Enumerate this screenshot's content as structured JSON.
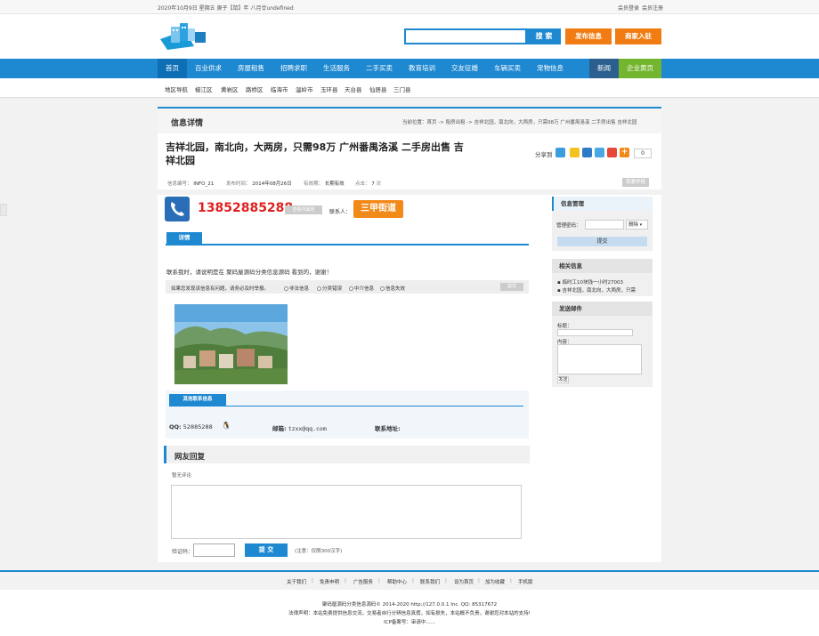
{
  "topbar": {
    "date": "2020年10月9日 星期五  庚子【鼠】年 八月廿undefined",
    "login": "会员登录",
    "register": "会员注册"
  },
  "header": {
    "search_placeholder": "",
    "search_button": "搜 索",
    "post_button": "发布信息",
    "merchant_button": "商家入驻"
  },
  "nav": {
    "items": [
      "首页",
      "百业供求",
      "房屋租售",
      "招聘求职",
      "生活服务",
      "二手买卖",
      "教育培训",
      "交友征婚",
      "车辆买卖",
      "宠物信息"
    ],
    "news": "新闻",
    "biz": "企业黄页"
  },
  "subnav": {
    "items": [
      "地区导航",
      "椒江区",
      "黄岩区",
      "路桥区",
      "临海市",
      "温岭市",
      "玉环县",
      "天台县",
      "仙居县",
      "三门县"
    ]
  },
  "title_bar": {
    "title": "信息详情",
    "breadcrumb": "当前位置：首页 -> 租房出租 -> 吉祥北园，南北向，大两房，只需98万 广州番禺洛溪 二手房出售 吉祥北园"
  },
  "post": {
    "title_line1": "吉祥北园，南北向，大两房，只需98万 广州番禺洛溪 二手房出售 吉",
    "title_line2": "祥北园",
    "share_label": "分享到",
    "share_count": "0",
    "meta": {
      "id_label": "信息编号：",
      "id_value": "INFO_21",
      "date_label": "发布时间：",
      "date_value": "2014年08月26日",
      "valid_label": "有效期：",
      "valid_value": "长期有效",
      "views_label": "点击：",
      "views_value": "7",
      "views_unit": "次"
    },
    "report_button": "我要举报",
    "phone": "13852885288",
    "phone_btn": "查看归属地",
    "contact_label": "联系人：",
    "contact_name": "三甲街道",
    "tab_detail": "详情",
    "description": "联系我时，请说明是在 聚码屋源码分类信息源码 看到的，谢谢！",
    "report_text": "如果您发现该信息有问题，请务必及时举报。",
    "report_options": [
      "非法信息",
      "分类错误",
      "中介信息",
      "信息失效"
    ],
    "report_submit": "提交"
  },
  "other_contact": {
    "tab": "其他联系信息",
    "qq_label": "QQ:",
    "qq_value": "52885288",
    "email_label": "邮箱:",
    "email_value": "tzxx@qq.com",
    "address_label": "联系地址:"
  },
  "reply": {
    "title": "网友回复",
    "no_comment": "暂无评论",
    "code_label": "验证码：",
    "submit": "提 交",
    "note": "(注意：仅限300汉字)"
  },
  "sidebar": {
    "manage": {
      "title": "信息管理",
      "password_label": "管理密码：",
      "action_select": "删除",
      "submit": "提交"
    },
    "related": {
      "title": "相关信息",
      "items": [
        "临时工10块钱一小时27003",
        "吉祥北园，南北向，大两房，只需"
      ]
    },
    "mail": {
      "title": "发送邮件",
      "subject_label": "标题：",
      "content_label": "内容：",
      "send_button": "发送"
    }
  },
  "footer": {
    "links": [
      "关于我们",
      "免责申明",
      "广告服务",
      "帮助中心",
      "联系我们",
      "设为首页",
      "加为收藏",
      "手机版"
    ],
    "copyright": "聚码屋源码分类信息源码© 2014-2020 http://127.0.0.1 Inc. QQ: 85317672",
    "disclaimer": "法律声明：本站免费提供信息交流，交易者自行分辨信息真假，如有损失，本站概不负责，谢谢您对本站的支持!",
    "icp": "ICP备案号：审请中......"
  },
  "colors": {
    "brand_blue": "#1e88d1",
    "orange": "#f07c13",
    "green": "#74b52f",
    "phone_red": "#e02020"
  }
}
